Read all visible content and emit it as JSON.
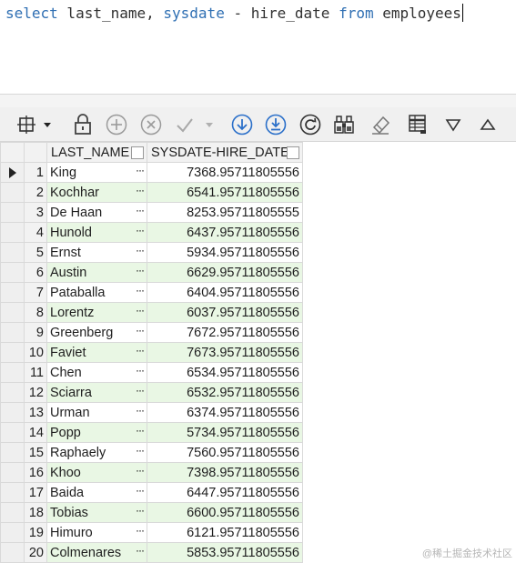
{
  "editor": {
    "tokens": [
      {
        "text": "select",
        "kw": true
      },
      {
        "text": " last_name, ",
        "kw": false
      },
      {
        "text": "sysdate",
        "kw": true
      },
      {
        "text": " - hire_date ",
        "kw": false
      },
      {
        "text": "from",
        "kw": true
      },
      {
        "text": " employees",
        "kw": false
      }
    ]
  },
  "toolbar": {
    "icons": [
      "grid-layout-icon",
      "dropdown-arrow-icon",
      "lock-icon",
      "add-row-icon",
      "delete-row-icon",
      "post-changes-icon",
      "post-dropdown-icon",
      "fetch-next-icon",
      "fetch-all-icon",
      "refresh-icon",
      "binoculars-icon",
      "clear-icon",
      "export-grid-icon",
      "sort-down-icon",
      "sort-up-icon"
    ],
    "accent": "#2a6fc9"
  },
  "grid": {
    "columns": [
      "LAST_NAME",
      "SYSDATE-HIRE_DATE"
    ],
    "rows": [
      {
        "n": "1",
        "last_name": "King",
        "value": "7368.95711805556"
      },
      {
        "n": "2",
        "last_name": "Kochhar",
        "value": "6541.95711805556"
      },
      {
        "n": "3",
        "last_name": "De Haan",
        "value": "8253.95711805555"
      },
      {
        "n": "4",
        "last_name": "Hunold",
        "value": "6437.95711805556"
      },
      {
        "n": "5",
        "last_name": "Ernst",
        "value": "5934.95711805556"
      },
      {
        "n": "6",
        "last_name": "Austin",
        "value": "6629.95711805556"
      },
      {
        "n": "7",
        "last_name": "Pataballa",
        "value": "6404.95711805556"
      },
      {
        "n": "8",
        "last_name": "Lorentz",
        "value": "6037.95711805556"
      },
      {
        "n": "9",
        "last_name": "Greenberg",
        "value": "7672.95711805556"
      },
      {
        "n": "10",
        "last_name": "Faviet",
        "value": "7673.95711805556"
      },
      {
        "n": "11",
        "last_name": "Chen",
        "value": "6534.95711805556"
      },
      {
        "n": "12",
        "last_name": "Sciarra",
        "value": "6532.95711805556"
      },
      {
        "n": "13",
        "last_name": "Urman",
        "value": "6374.95711805556"
      },
      {
        "n": "14",
        "last_name": "Popp",
        "value": "5734.95711805556"
      },
      {
        "n": "15",
        "last_name": "Raphaely",
        "value": "7560.95711805556"
      },
      {
        "n": "16",
        "last_name": "Khoo",
        "value": "7398.95711805556"
      },
      {
        "n": "17",
        "last_name": "Baida",
        "value": "6447.95711805556"
      },
      {
        "n": "18",
        "last_name": "Tobias",
        "value": "6600.95711805556"
      },
      {
        "n": "19",
        "last_name": "Himuro",
        "value": "6121.95711805556"
      },
      {
        "n": "20",
        "last_name": "Colmenares",
        "value": "5853.95711805556"
      }
    ],
    "ellipsis": "···",
    "current_row": "1",
    "colors": {
      "even_row": "#e9f7e4",
      "keyword": "#2f6fb3"
    }
  },
  "watermark": "@稀土掘金技术社区"
}
